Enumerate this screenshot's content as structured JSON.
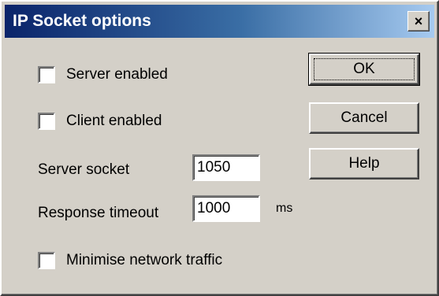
{
  "window": {
    "title": "IP Socket options",
    "close_glyph": "✕"
  },
  "options": {
    "server_enabled": {
      "label": "Server enabled",
      "checked": false
    },
    "client_enabled": {
      "label": "Client enabled",
      "checked": false
    },
    "minimise_traffic": {
      "label": "Minimise network traffic",
      "checked": false
    }
  },
  "fields": {
    "server_socket": {
      "label": "Server socket",
      "value": "1050"
    },
    "response_timeout": {
      "label": "Response timeout",
      "value": "1000",
      "unit": "ms"
    }
  },
  "buttons": {
    "ok": "OK",
    "cancel": "Cancel",
    "help": "Help"
  }
}
